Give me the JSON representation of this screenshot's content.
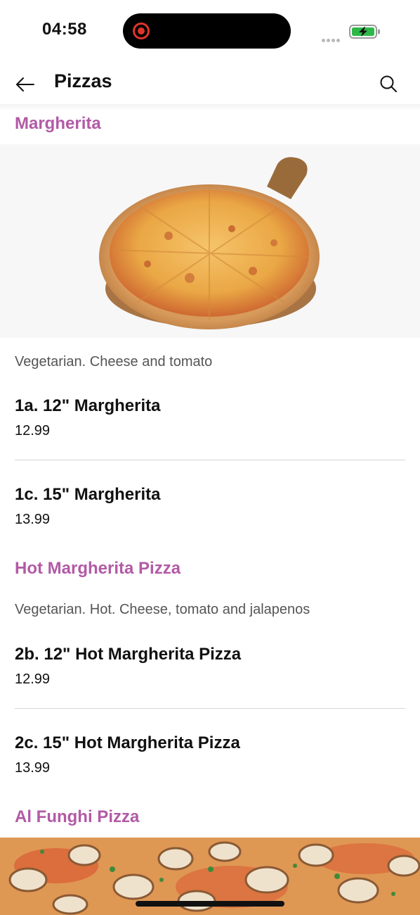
{
  "status": {
    "time": "04:58"
  },
  "header": {
    "title": "Pizzas"
  },
  "categories": [
    {
      "title": "Margherita",
      "description": "Vegetarian. Cheese and tomato",
      "items": [
        {
          "name": "1a. 12\" Margherita",
          "price": "12.99"
        },
        {
          "name": "1c. 15\" Margherita",
          "price": "13.99"
        }
      ]
    },
    {
      "title": "Hot Margherita Pizza",
      "description": "Vegetarian. Hot. Cheese, tomato and jalapenos",
      "items": [
        {
          "name": "2b. 12\" Hot Margherita Pizza",
          "price": "12.99"
        },
        {
          "name": "2c. 15\" Hot Margherita Pizza",
          "price": "13.99"
        }
      ]
    },
    {
      "title": "Al Funghi Pizza"
    }
  ],
  "colors": {
    "accent": "#b25aa6",
    "text": "#111111",
    "muted": "#555555",
    "battery": "#2fb84a",
    "record": "#e0342a"
  },
  "icons": [
    "back-arrow-icon",
    "search-icon",
    "record-icon",
    "battery-charging-icon",
    "signal-dots-icon"
  ]
}
